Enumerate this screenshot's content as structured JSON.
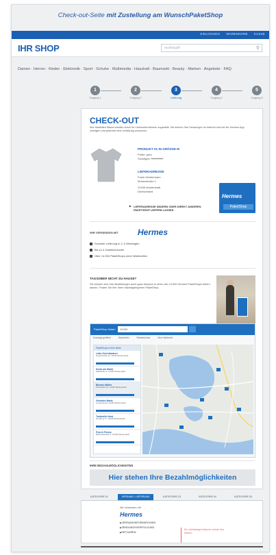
{
  "frame_title": {
    "plain": "Check-out-Seite ",
    "bold": "mit Zustellung am WunschPaketShop"
  },
  "topbar": {
    "links": [
      "EINLOGGEN",
      "WARENKORB",
      "KASSE"
    ]
  },
  "header": {
    "logo": "IHR SHOP",
    "search_placeholder": "Suchbegriff",
    "search_icon": "search-icon"
  },
  "nav": {
    "text": "Damen · Herren · Kinder · Elektronik · Sport · Schuhe · Multimedia · Haushalt · Baumarkt · Beauty · Marken · Angebote · FAQ"
  },
  "steps": [
    {
      "num": "1",
      "label": "Vorgang 1",
      "active": false
    },
    {
      "num": "2",
      "label": "Vorgang 2",
      "active": false
    },
    {
      "num": "3",
      "label": "Lieferung",
      "active": true
    },
    {
      "num": "4",
      "label": "Vorgang 4",
      "active": false
    },
    {
      "num": "5",
      "label": "Vorgang 5",
      "active": false
    }
  ],
  "checkout": {
    "title": "CHECK-OUT",
    "intro": "Ihre bestellten Waren werden durch Ihr Lieferunternehmen zugestellt. Sie können Ihre Sendungen im Internet und mit der Hermes App verfolgen und jederzeit eine Umleitung wünschen.",
    "product": {
      "title": "PRODUKT 01 IN GRÖSSE M",
      "color": "Farbe: grau",
      "price_label": "Sonstiges: ",
      "price": "0,00 EUR"
    },
    "address": {
      "title": "LIEFERADRESSE",
      "lines": [
        "Frank Mustermann",
        "Musterstraße 1",
        "12345 Musterstadt",
        "Deutschland"
      ]
    },
    "hermes_badge": {
      "logo": "Hermes",
      "sub": "PaketShop"
    },
    "change_address": "LIEFERADRESSE ÄNDERN ODER DIREKT ANDEREN PAKETSHOP LIEFERN LASSEN",
    "wir_versenden": "WIR VERSENDEN MIT",
    "hermes_logo": "Hermes",
    "features": [
      "Schnelle Lieferung in 2–3 Werktagen",
      "Bis zu 4 Zustellversuche",
      "Über 14.000 PaketShops ohne Wartezeiten"
    ],
    "tages": {
      "title": "TAGSÜBER NICHT ZU HAUSE?",
      "text": "Sie können sich Ihre Bestellungen auch ganz bequem in einen der 14.000 Hermes PaketShops liefern lassen. Finden Sie hier Ihren nächstgelegenen PaketShop."
    },
    "map": {
      "search_label": "PaketShop finden",
      "search_value": "12345",
      "filters": [
        "Sonntags geöffnet",
        "Barrierefrei",
        "Paketautomat",
        "Ohne Wartezeit"
      ],
      "list_header": "PaketShops in Ihrer Nähe",
      "shops": [
        {
          "name": "Lotto Schreibwaren",
          "addr": "Hauptstraße 12, 12345 Musterstadt"
        },
        {
          "name": "Kiosk am Markt",
          "addr": "Marktplatz 3, 12345 Musterstadt"
        },
        {
          "name": "Blumen Müller",
          "addr": "Seestraße 45, 12345 Musterstadt"
        },
        {
          "name": "Getränke Markt",
          "addr": "Lindenweg 8, 12345 Musterstadt"
        },
        {
          "name": "Tankstelle Nord",
          "addr": "Nordring 77, 12345 Musterstadt"
        },
        {
          "name": "Post & Presse",
          "addr": "Bahnhofstraße 2, 12345 Musterstadt"
        }
      ]
    },
    "payment": {
      "title": "IHRE BEZAHLMÖGLICHKEITEN",
      "placeholder": "Hier stehen Ihre Bezahlmöglichkeiten"
    }
  },
  "tabs": [
    "KATEGORIE 01",
    "VERSAND / LIEFERUNG",
    "KATEGORIE 03",
    "KATEGORIE 04",
    "KATEGORIE 05"
  ],
  "tabpanel": {
    "title": "Wir versenden mit",
    "hermes": "Hermes",
    "links": [
      "VERSANDINFORMATIONEN",
      "SENDUNGSVERFOLGUNG",
      "RETOUREN"
    ],
    "note": "Ein dreifarbiges Banner würde hier stehen."
  },
  "colors": {
    "brand": "#1b5fb3",
    "accent": "#1e6fc0",
    "note": "#e4606a"
  }
}
